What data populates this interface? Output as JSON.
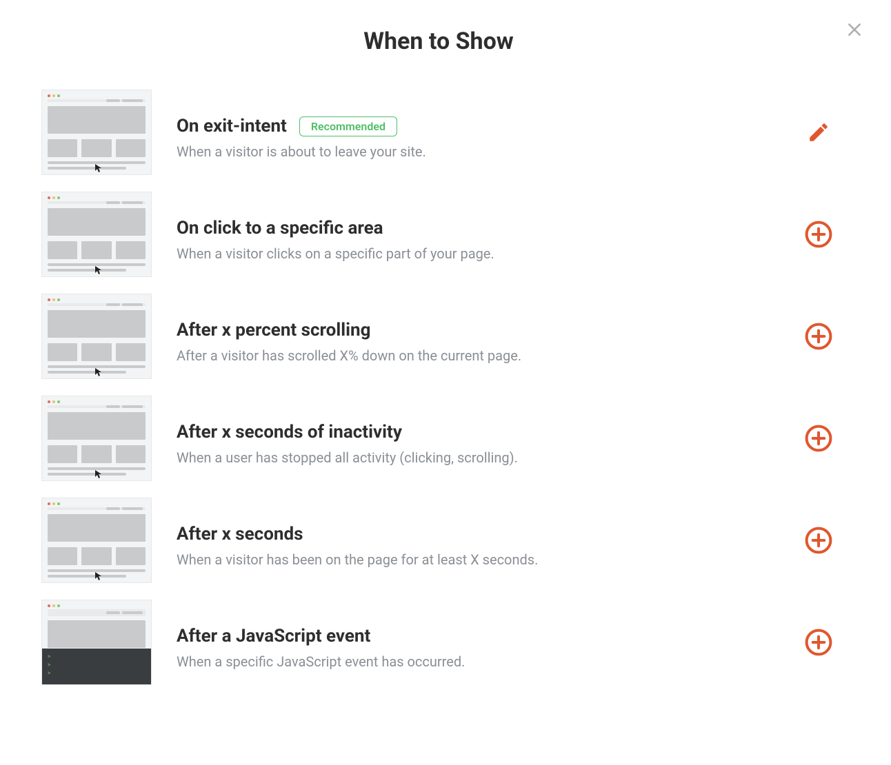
{
  "modal": {
    "title": "When to Show",
    "badge_label": "Recommended"
  },
  "triggers": [
    {
      "id": "exit-intent",
      "title": "On exit-intent",
      "description": "When a visitor is about to leave your site.",
      "recommended": true,
      "action": "edit"
    },
    {
      "id": "click-area",
      "title": "On click to a specific area",
      "description": "When a visitor clicks on a specific part of your page.",
      "recommended": false,
      "action": "add"
    },
    {
      "id": "scroll-percent",
      "title": "After x percent scrolling",
      "description": "After a visitor has scrolled X% down on the current page.",
      "recommended": false,
      "action": "add"
    },
    {
      "id": "inactivity",
      "title": "After x seconds of inactivity",
      "description": "When a user has stopped all activity (clicking, scrolling).",
      "recommended": false,
      "action": "add"
    },
    {
      "id": "seconds",
      "title": "After x seconds",
      "description": "When a visitor has been on the page for at least X seconds.",
      "recommended": false,
      "action": "add"
    },
    {
      "id": "js-event",
      "title": "After a JavaScript event",
      "description": "When a specific JavaScript event has occurred.",
      "recommended": false,
      "action": "add"
    }
  ]
}
